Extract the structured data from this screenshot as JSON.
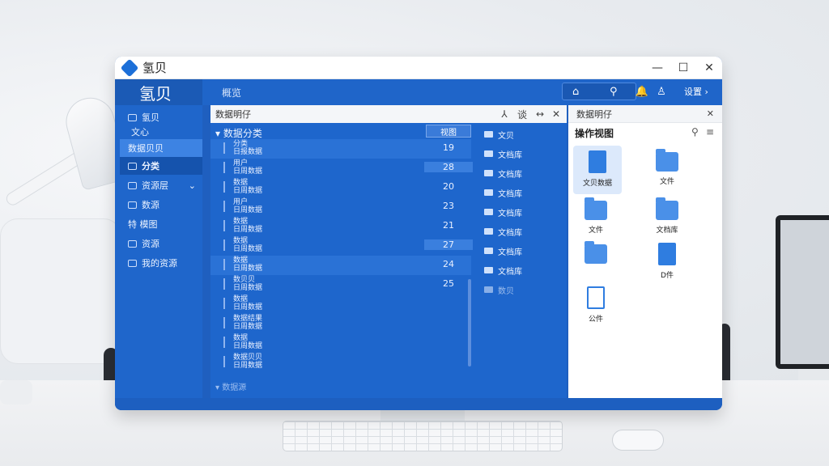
{
  "window": {
    "title": "氢贝",
    "controls": [
      "—",
      "☐",
      "✕"
    ]
  },
  "topbar": {
    "brand": "氢贝",
    "hint": "概览",
    "home_icon": "⌂",
    "search_icon": "⚲",
    "bell_icon": "🔔",
    "user_icon": "♙",
    "settings_label": "设置 ›"
  },
  "sidebar": {
    "items": [
      {
        "label": "氢贝"
      },
      {
        "label": "文心"
      },
      {
        "label": "数据贝贝"
      },
      {
        "label": "分类"
      },
      {
        "label": "资源层"
      },
      {
        "label": "数源"
      },
      {
        "label": "特 模图"
      },
      {
        "label": "资源"
      },
      {
        "label": "我的资源"
      }
    ]
  },
  "datapanel": {
    "header": "数据明仔",
    "tool_icons": [
      "⅄",
      "谈",
      "↔",
      "✕"
    ],
    "category_title": "▾ 数据分类",
    "category_button": "视图",
    "rows": [
      {
        "label": "分类\n日报数据",
        "num": "19"
      },
      {
        "label": "用户\n日周数据",
        "num": "28"
      },
      {
        "label": "数据\n日周数据",
        "num": "20"
      },
      {
        "label": "用户\n日周数据",
        "num": "23"
      },
      {
        "label": "数据\n日周数据",
        "num": "21"
      },
      {
        "label": "数据\n日周数据",
        "num": "27"
      },
      {
        "label": "数据\n日周数据",
        "num": "24"
      },
      {
        "label": "数贝贝\n日周数据",
        "num": "25"
      },
      {
        "label": "数据\n日周数据",
        "num": ""
      },
      {
        "label": "数据结果\n日周数据",
        "num": ""
      },
      {
        "label": "数据\n日周数据",
        "num": ""
      },
      {
        "label": "数据贝贝\n日周数据",
        "num": ""
      }
    ],
    "footer": "▾ 数据源",
    "folders": [
      {
        "label": "文贝"
      },
      {
        "label": "文档库"
      },
      {
        "label": "文档库"
      },
      {
        "label": "文档库"
      },
      {
        "label": "文档库"
      },
      {
        "label": "文档库"
      },
      {
        "label": "文档库"
      },
      {
        "label": "文档库"
      },
      {
        "label": "数贝"
      }
    ]
  },
  "filepanel": {
    "header": "数据明仔",
    "subtitle": "操作视图",
    "tiles": [
      {
        "label": "文贝数据"
      },
      {
        "label": "文件"
      },
      {
        "label": "文件"
      },
      {
        "label": "文档库"
      },
      {
        "label": ""
      },
      {
        "label": "D件"
      },
      {
        "label": "公件"
      }
    ]
  },
  "colors": {
    "accent": "#1f66cb",
    "panel": "#1e66cc",
    "highlight": "#3d83e3"
  }
}
